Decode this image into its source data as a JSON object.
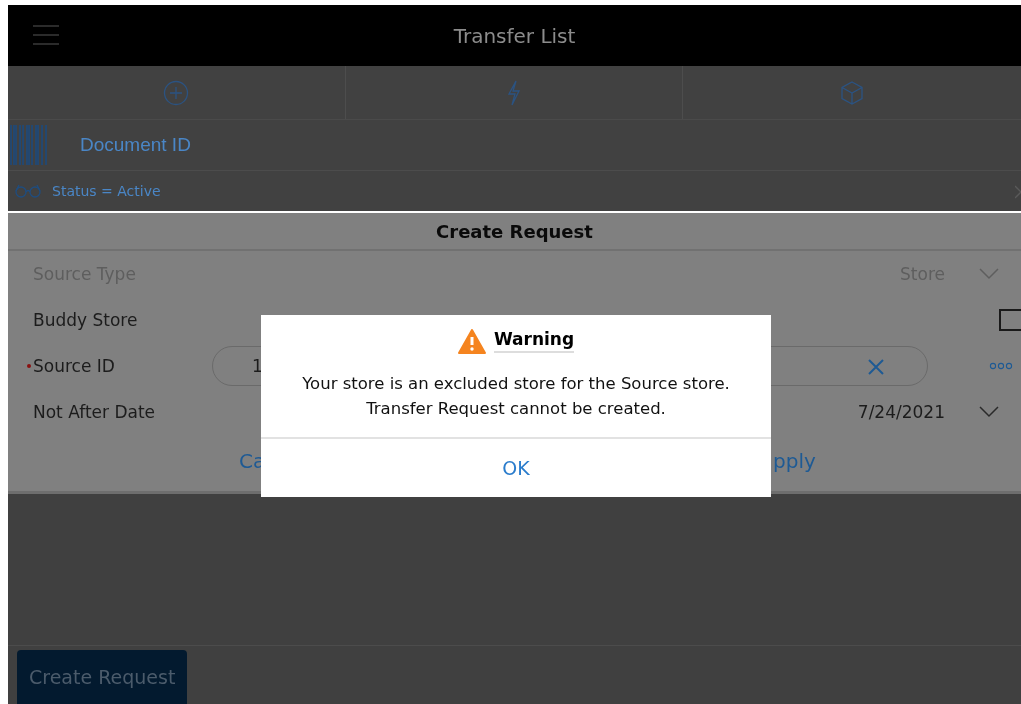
{
  "header": {
    "title": "Transfer List"
  },
  "search": {
    "placeholder": "Document ID"
  },
  "filter": {
    "label": "Status = Active"
  },
  "panel": {
    "title": "Create Request",
    "fields": [
      {
        "kind": "select",
        "label": "Source Type",
        "value": "Store",
        "disabled": true
      },
      {
        "kind": "checkbox",
        "label": "Buddy Store",
        "checked": false
      },
      {
        "kind": "input",
        "label": "Source ID",
        "required": true,
        "value": "1"
      },
      {
        "kind": "select",
        "label": "Not After Date",
        "value": "7/24/2021",
        "disabled": false
      }
    ],
    "buttons": [
      "Ca",
      "pply"
    ]
  },
  "dialog": {
    "title": "Warning",
    "message": [
      "Your store is an excluded store for the Source store.",
      "Transfer Request cannot be created."
    ],
    "button": "OK"
  },
  "footer": {
    "button": "Create Request"
  }
}
